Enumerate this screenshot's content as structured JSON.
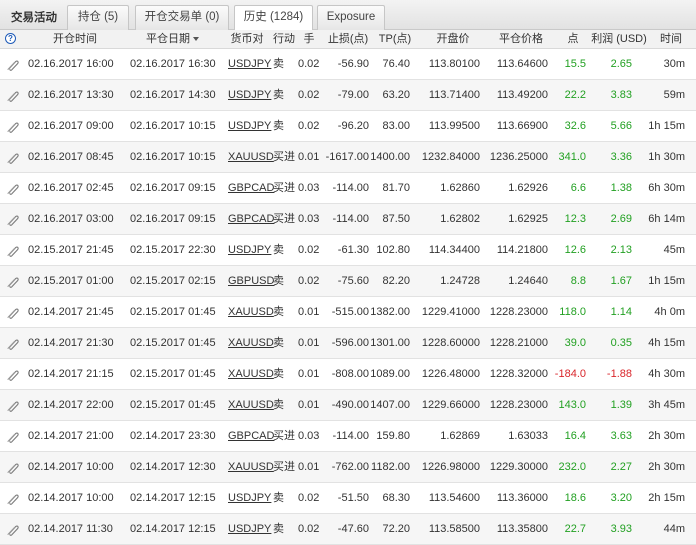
{
  "tabs": {
    "title": "交易活动",
    "items": [
      "持仓 (5)",
      "开仓交易单 (0)",
      "历史 (1284)",
      "Exposure"
    ],
    "active_index": 2
  },
  "columns": {
    "help": "?",
    "open_time": "开仓时间",
    "close_date": "平仓日期",
    "pair": "货币对",
    "action": "行动",
    "lots": "手",
    "sl": "止损(点)",
    "tp": "TP(点)",
    "open_price": "开盘价",
    "close_price": "平仓价格",
    "points": "点",
    "profit": "利润 (USD)",
    "time": "时间"
  },
  "colors": {
    "positive": "#22a022",
    "negative": "#d9262b"
  },
  "rows": [
    {
      "open": "02.16.2017 16:00",
      "close": "02.16.2017 16:30",
      "pair": "USDJPY",
      "action": "卖",
      "lots": "0.02",
      "sl": "-56.90",
      "tp": "76.40",
      "open_price": "113.80100",
      "close_price": "113.64600",
      "points": "15.5",
      "profit": "2.65",
      "time": "30m",
      "negative": false
    },
    {
      "open": "02.16.2017 13:30",
      "close": "02.16.2017 14:30",
      "pair": "USDJPY",
      "action": "卖",
      "lots": "0.02",
      "sl": "-79.00",
      "tp": "63.20",
      "open_price": "113.71400",
      "close_price": "113.49200",
      "points": "22.2",
      "profit": "3.83",
      "time": "59m",
      "negative": false
    },
    {
      "open": "02.16.2017 09:00",
      "close": "02.16.2017 10:15",
      "pair": "USDJPY",
      "action": "卖",
      "lots": "0.02",
      "sl": "-96.20",
      "tp": "83.00",
      "open_price": "113.99500",
      "close_price": "113.66900",
      "points": "32.6",
      "profit": "5.66",
      "time": "1h 15m",
      "negative": false
    },
    {
      "open": "02.16.2017 08:45",
      "close": "02.16.2017 10:15",
      "pair": "XAUUSD",
      "action": "买进",
      "lots": "0.01",
      "sl": "-1617.00",
      "tp": "1400.00",
      "open_price": "1232.84000",
      "close_price": "1236.25000",
      "points": "341.0",
      "profit": "3.36",
      "time": "1h 30m",
      "negative": false
    },
    {
      "open": "02.16.2017 02:45",
      "close": "02.16.2017 09:15",
      "pair": "GBPCAD",
      "action": "买进",
      "lots": "0.03",
      "sl": "-114.00",
      "tp": "81.70",
      "open_price": "1.62860",
      "close_price": "1.62926",
      "points": "6.6",
      "profit": "1.38",
      "time": "6h 30m",
      "negative": false
    },
    {
      "open": "02.16.2017 03:00",
      "close": "02.16.2017 09:15",
      "pair": "GBPCAD",
      "action": "买进",
      "lots": "0.03",
      "sl": "-114.00",
      "tp": "87.50",
      "open_price": "1.62802",
      "close_price": "1.62925",
      "points": "12.3",
      "profit": "2.69",
      "time": "6h 14m",
      "negative": false
    },
    {
      "open": "02.15.2017 21:45",
      "close": "02.15.2017 22:30",
      "pair": "USDJPY",
      "action": "卖",
      "lots": "0.02",
      "sl": "-61.30",
      "tp": "102.80",
      "open_price": "114.34400",
      "close_price": "114.21800",
      "points": "12.6",
      "profit": "2.13",
      "time": "45m",
      "negative": false
    },
    {
      "open": "02.15.2017 01:00",
      "close": "02.15.2017 02:15",
      "pair": "GBPUSD",
      "action": "卖",
      "lots": "0.02",
      "sl": "-75.60",
      "tp": "82.20",
      "open_price": "1.24728",
      "close_price": "1.24640",
      "points": "8.8",
      "profit": "1.67",
      "time": "1h 15m",
      "negative": false
    },
    {
      "open": "02.14.2017 21:45",
      "close": "02.15.2017 01:45",
      "pair": "XAUUSD",
      "action": "卖",
      "lots": "0.01",
      "sl": "-515.00",
      "tp": "1382.00",
      "open_price": "1229.41000",
      "close_price": "1228.23000",
      "points": "118.0",
      "profit": "1.14",
      "time": "4h 0m",
      "negative": false
    },
    {
      "open": "02.14.2017 21:30",
      "close": "02.15.2017 01:45",
      "pair": "XAUUSD",
      "action": "卖",
      "lots": "0.01",
      "sl": "-596.00",
      "tp": "1301.00",
      "open_price": "1228.60000",
      "close_price": "1228.21000",
      "points": "39.0",
      "profit": "0.35",
      "time": "4h 15m",
      "negative": false
    },
    {
      "open": "02.14.2017 21:15",
      "close": "02.15.2017 01:45",
      "pair": "XAUUSD",
      "action": "卖",
      "lots": "0.01",
      "sl": "-808.00",
      "tp": "1089.00",
      "open_price": "1226.48000",
      "close_price": "1228.32000",
      "points": "-184.0",
      "profit": "-1.88",
      "time": "4h 30m",
      "negative": true
    },
    {
      "open": "02.14.2017 22:00",
      "close": "02.15.2017 01:45",
      "pair": "XAUUSD",
      "action": "卖",
      "lots": "0.01",
      "sl": "-490.00",
      "tp": "1407.00",
      "open_price": "1229.66000",
      "close_price": "1228.23000",
      "points": "143.0",
      "profit": "1.39",
      "time": "3h 45m",
      "negative": false
    },
    {
      "open": "02.14.2017 21:00",
      "close": "02.14.2017 23:30",
      "pair": "GBPCAD",
      "action": "买进",
      "lots": "0.03",
      "sl": "-114.00",
      "tp": "159.80",
      "open_price": "1.62869",
      "close_price": "1.63033",
      "points": "16.4",
      "profit": "3.63",
      "time": "2h 30m",
      "negative": false
    },
    {
      "open": "02.14.2017 10:00",
      "close": "02.14.2017 12:30",
      "pair": "XAUUSD",
      "action": "买进",
      "lots": "0.01",
      "sl": "-762.00",
      "tp": "1182.00",
      "open_price": "1226.98000",
      "close_price": "1229.30000",
      "points": "232.0",
      "profit": "2.27",
      "time": "2h 30m",
      "negative": false
    },
    {
      "open": "02.14.2017 10:00",
      "close": "02.14.2017 12:15",
      "pair": "USDJPY",
      "action": "卖",
      "lots": "0.02",
      "sl": "-51.50",
      "tp": "68.30",
      "open_price": "113.54600",
      "close_price": "113.36000",
      "points": "18.6",
      "profit": "3.20",
      "time": "2h 15m",
      "negative": false
    },
    {
      "open": "02.14.2017 11:30",
      "close": "02.14.2017 12:15",
      "pair": "USDJPY",
      "action": "卖",
      "lots": "0.02",
      "sl": "-47.60",
      "tp": "72.20",
      "open_price": "113.58500",
      "close_price": "113.35800",
      "points": "22.7",
      "profit": "3.93",
      "time": "44m",
      "negative": false
    }
  ]
}
